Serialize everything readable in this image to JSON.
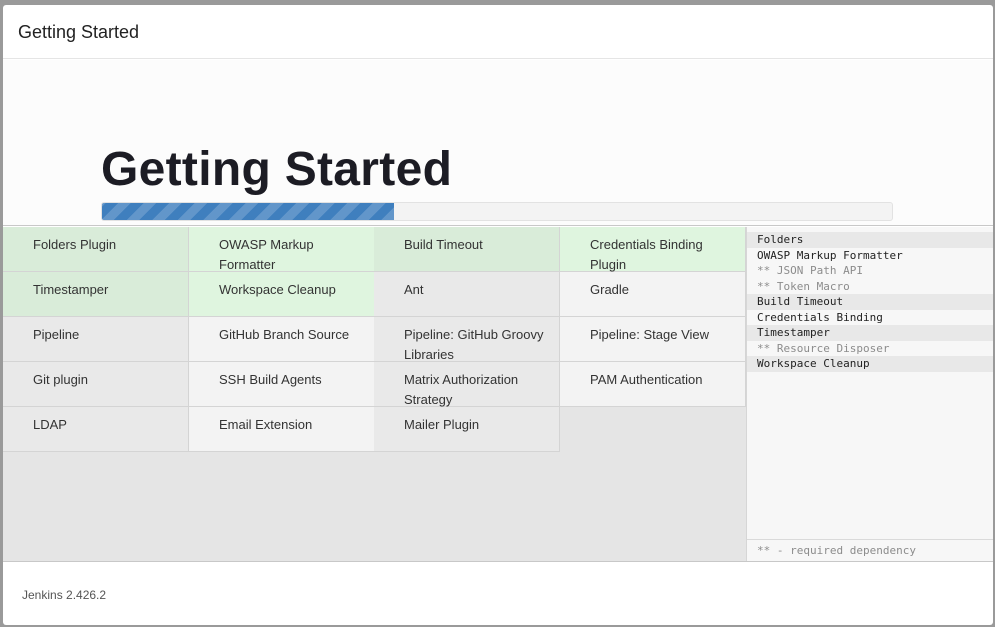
{
  "dialog": {
    "title": "Getting Started"
  },
  "hero": {
    "title": "Getting Started",
    "progress_percent": 37
  },
  "plugins": [
    {
      "name": "Folders Plugin",
      "state": "success"
    },
    {
      "name": "OWASP Markup Formatter",
      "state": "success-light"
    },
    {
      "name": "Build Timeout",
      "state": "success"
    },
    {
      "name": "Credentials Binding Plugin",
      "state": "success-light"
    },
    {
      "name": "Timestamper",
      "state": "success"
    },
    {
      "name": "Workspace Cleanup",
      "state": "success-light"
    },
    {
      "name": "Ant",
      "state": "pending"
    },
    {
      "name": "Gradle",
      "state": "pending-light"
    },
    {
      "name": "Pipeline",
      "state": "pending"
    },
    {
      "name": "GitHub Branch Source",
      "state": "pending-light"
    },
    {
      "name": "Pipeline: GitHub Groovy Libraries",
      "state": "pending"
    },
    {
      "name": "Pipeline: Stage View",
      "state": "pending-light"
    },
    {
      "name": "Git plugin",
      "state": "pending"
    },
    {
      "name": "SSH Build Agents",
      "state": "pending-light"
    },
    {
      "name": "Matrix Authorization Strategy",
      "state": "pending"
    },
    {
      "name": "PAM Authentication",
      "state": "pending-light"
    },
    {
      "name": "LDAP",
      "state": "pending"
    },
    {
      "name": "Email Extension",
      "state": "pending-light"
    },
    {
      "name": "Mailer Plugin",
      "state": "pending"
    }
  ],
  "log": {
    "lines": [
      {
        "text": "Folders",
        "dependency": false,
        "shaded": true
      },
      {
        "text": "OWASP Markup Formatter",
        "dependency": false,
        "shaded": false
      },
      {
        "text": "** JSON Path API",
        "dependency": true,
        "shaded": false
      },
      {
        "text": "** Token Macro",
        "dependency": true,
        "shaded": false
      },
      {
        "text": "Build Timeout",
        "dependency": false,
        "shaded": true
      },
      {
        "text": "Credentials Binding",
        "dependency": false,
        "shaded": false
      },
      {
        "text": "Timestamper",
        "dependency": false,
        "shaded": true
      },
      {
        "text": "** Resource Disposer",
        "dependency": true,
        "shaded": false
      },
      {
        "text": "Workspace Cleanup",
        "dependency": false,
        "shaded": true
      }
    ],
    "footer": "** - required dependency"
  },
  "footer": {
    "version": "Jenkins 2.426.2"
  },
  "colors": {
    "progress": "#3f7fbe",
    "installed": "#d9ecd9",
    "pending": "#e9e9e9"
  }
}
